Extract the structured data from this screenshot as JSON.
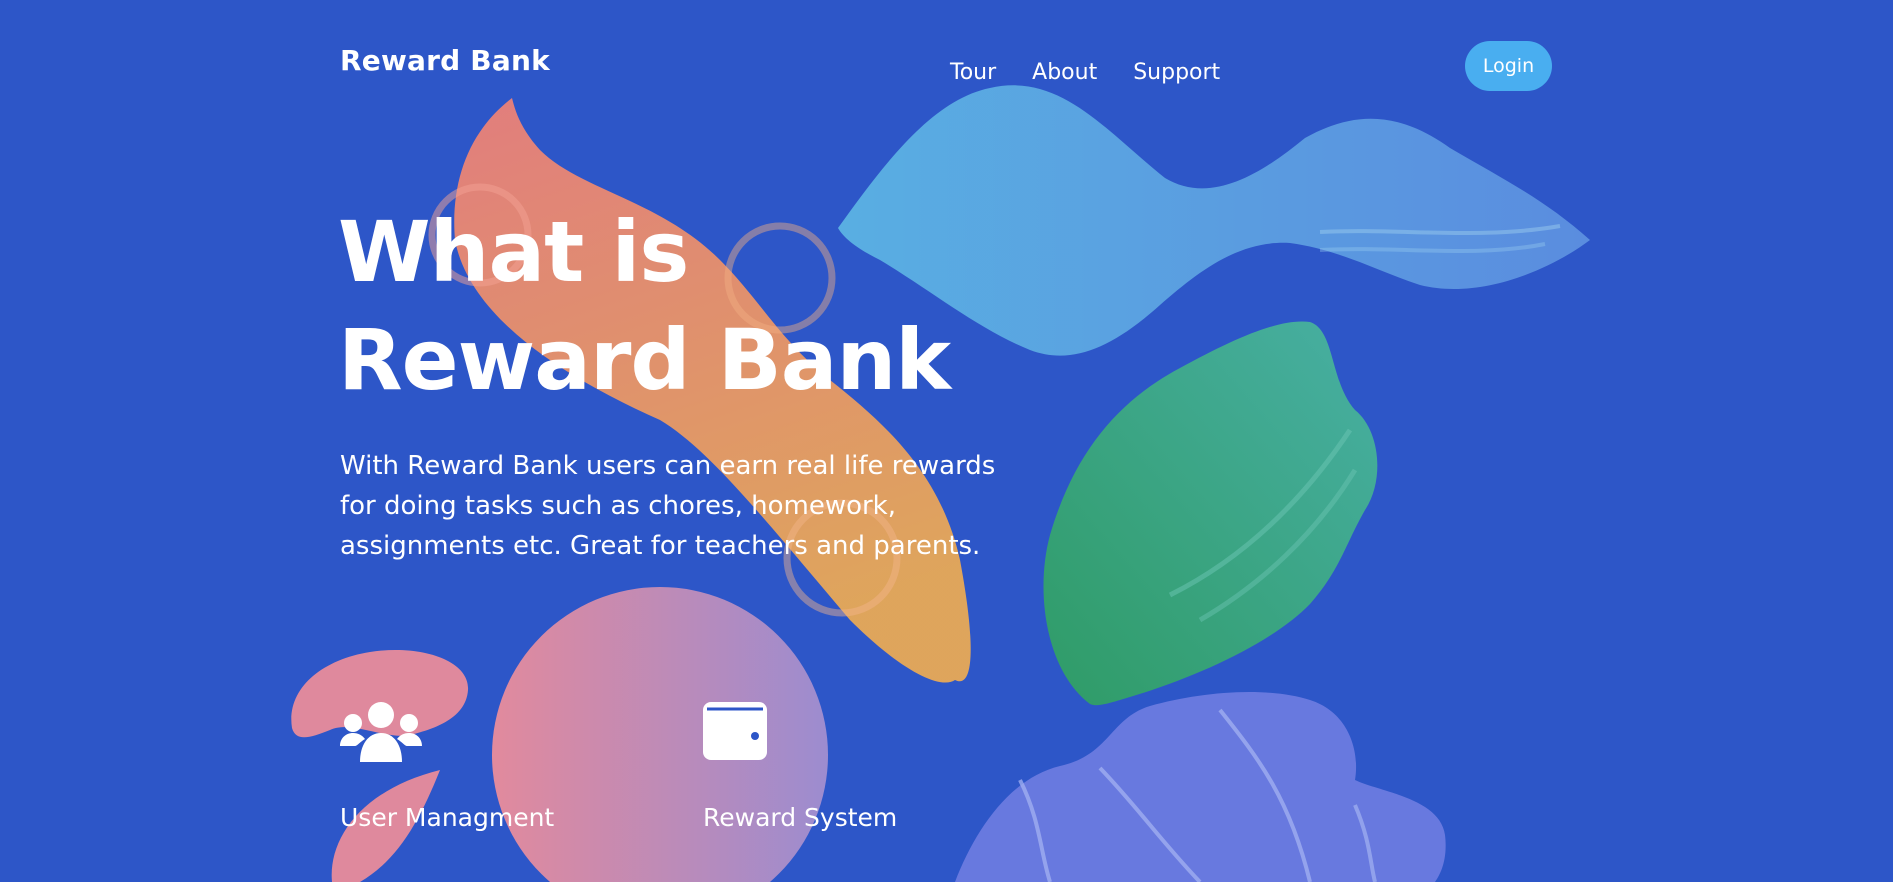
{
  "brand": "Reward Bank",
  "nav": {
    "links": [
      {
        "label": "Tour"
      },
      {
        "label": "About"
      },
      {
        "label": "Support"
      }
    ],
    "login_label": "Login"
  },
  "hero": {
    "title_line_1": "What is",
    "title_line_2": "Reward Bank",
    "description": "With Reward Bank users can earn real life rewards for doing tasks such as chores, homework, assignments etc. Great for teachers and parents."
  },
  "features": [
    {
      "icon": "users-icon",
      "label": "User Managment"
    },
    {
      "icon": "wallet-icon",
      "label": "Reward System"
    }
  ],
  "colors": {
    "background": "#2d56c8",
    "login_button": "#49aef0"
  }
}
